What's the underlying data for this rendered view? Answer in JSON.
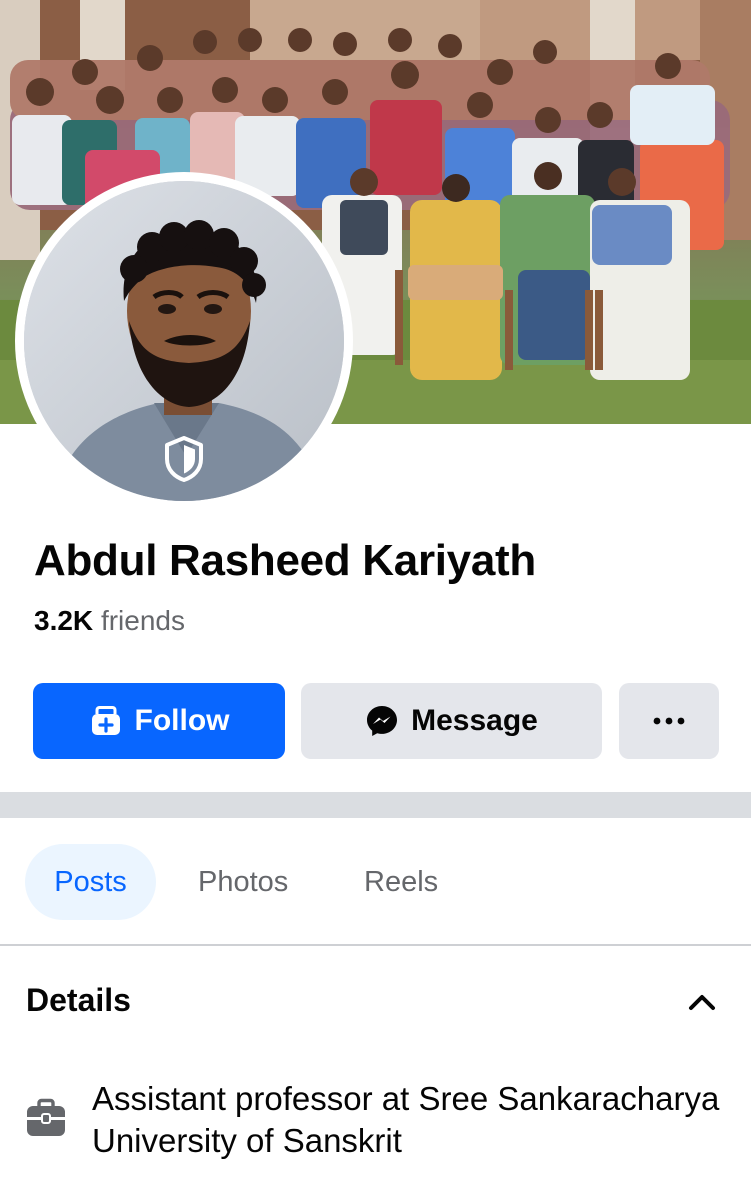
{
  "profile": {
    "name": "Abdul Rasheed Kariyath",
    "friends_count": "3.2K",
    "friends_label": "friends"
  },
  "actions": {
    "follow_label": "Follow",
    "message_label": "Message",
    "more_label": "•••"
  },
  "tabs": [
    {
      "label": "Posts",
      "selected": true
    },
    {
      "label": "Photos",
      "selected": false
    },
    {
      "label": "Reels",
      "selected": false
    }
  ],
  "details": {
    "title": "Details",
    "work": "Assistant professor at Sree Sankaracharya University of Sanskrit"
  },
  "icons": {
    "shield": "shield-icon",
    "follow": "follow-icon",
    "message": "messenger-icon",
    "more": "more-icon",
    "chevron": "chevron-up-icon",
    "briefcase": "briefcase-icon"
  },
  "colors": {
    "accent": "#0866ff",
    "secondary_button": "#e4e6eb",
    "selected_tab_bg": "#ebf5ff",
    "muted_text": "#65676b"
  }
}
